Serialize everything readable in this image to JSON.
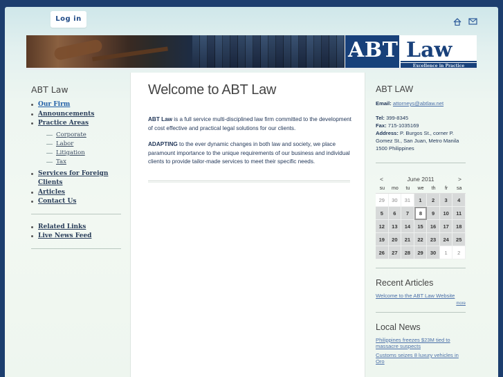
{
  "header": {
    "login_label": "Log in",
    "icons": [
      "home-icon",
      "mail-icon"
    ]
  },
  "banner": {
    "logo_left": "ABT",
    "logo_right": "Law",
    "tagline": "Excellence in Practice"
  },
  "left": {
    "title": "ABT Law",
    "nav": [
      {
        "label": "Our Firm",
        "active": true
      },
      {
        "label": "Announcements"
      },
      {
        "label": "Practice Areas"
      }
    ],
    "practice_areas": [
      "Corporate",
      "Labor",
      "Litigation",
      "Tax"
    ],
    "nav2": [
      "Services for Foreign Clients",
      "Articles",
      "Contact Us"
    ],
    "links": [
      "Related Links",
      "Live News Feed"
    ]
  },
  "main": {
    "title": "Welcome to ABT Law",
    "p1_bold": "ABT Law",
    "p1_rest": " is a full service multi-disciplined law firm committed to the development of cost effective and practical legal solutions for our clients.",
    "p2_bold": "ADAPTING",
    "p2_rest": " to the ever dynamic changes in both law and society, we place paramount importance to the unique requirements of our business and individual clients to provide tailor-made services to meet their specific needs."
  },
  "right": {
    "title": "ABT LAW",
    "email_label": "Email:",
    "email": "attorneys@abtlaw.net",
    "tel_label": "Tel:",
    "tel": "399-8345",
    "fax_label": "Fax:",
    "fax": "715-1035169",
    "address_label": "Address:",
    "address": "P. Burgos St., corner P. Gomez St., San Juan, Metro Manila 1500 Philippines",
    "calendar": {
      "prev": "<",
      "next": ">",
      "month": "June 2011",
      "days": [
        "su",
        "mo",
        "tu",
        "we",
        "th",
        "fr",
        "sa"
      ],
      "weeks": [
        [
          [
            "29",
            "other"
          ],
          [
            "30",
            "other"
          ],
          [
            "31",
            "other"
          ],
          [
            "1",
            ""
          ],
          [
            "2",
            ""
          ],
          [
            "3",
            ""
          ],
          [
            "4",
            ""
          ]
        ],
        [
          [
            "5",
            ""
          ],
          [
            "6",
            ""
          ],
          [
            "7",
            ""
          ],
          [
            "8",
            "today"
          ],
          [
            "9",
            ""
          ],
          [
            "10",
            ""
          ],
          [
            "11",
            ""
          ]
        ],
        [
          [
            "12",
            ""
          ],
          [
            "13",
            ""
          ],
          [
            "14",
            ""
          ],
          [
            "15",
            ""
          ],
          [
            "16",
            ""
          ],
          [
            "17",
            ""
          ],
          [
            "18",
            ""
          ]
        ],
        [
          [
            "19",
            ""
          ],
          [
            "20",
            ""
          ],
          [
            "21",
            ""
          ],
          [
            "22",
            ""
          ],
          [
            "23",
            ""
          ],
          [
            "24",
            ""
          ],
          [
            "25",
            ""
          ]
        ],
        [
          [
            "26",
            ""
          ],
          [
            "27",
            ""
          ],
          [
            "28",
            ""
          ],
          [
            "29",
            ""
          ],
          [
            "30",
            ""
          ],
          [
            "1",
            "other"
          ],
          [
            "2",
            "other"
          ]
        ]
      ]
    },
    "recent_title": "Recent Articles",
    "recent_link": "Welcome to the ABT Law Website",
    "more_label": "more",
    "news_title": "Local News",
    "news": [
      "Philippines freezes $23M tied to massacre suspects",
      "Customs seizes 8 luxury vehicles in Oro"
    ]
  }
}
